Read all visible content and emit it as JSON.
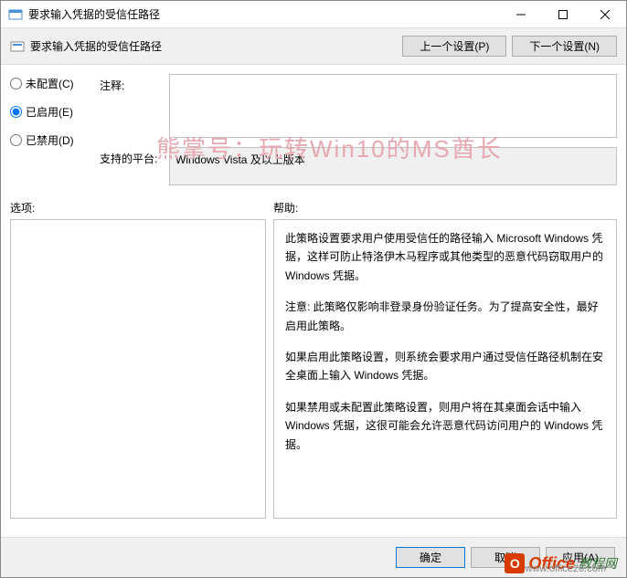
{
  "titlebar": {
    "title": "要求输入凭据的受信任路径"
  },
  "subheader": {
    "title": "要求输入凭据的受信任路径",
    "prev_btn": "上一个设置(P)",
    "next_btn": "下一个设置(N)"
  },
  "radios": {
    "not_configured": "未配置(C)",
    "enabled": "已启用(E)",
    "disabled": "已禁用(D)"
  },
  "fields": {
    "comment_label": "注释:",
    "comment_value": "",
    "platform_label": "支持的平台:",
    "platform_value": "Windows Vista 及以上版本"
  },
  "mid": {
    "options_label": "选项:",
    "help_label": "帮助:"
  },
  "help": {
    "p1": "此策略设置要求用户使用受信任的路径输入 Microsoft Windows 凭据，这样可防止特洛伊木马程序或其他类型的恶意代码窃取用户的 Windows 凭据。",
    "p2": "注意: 此策略仅影响非登录身份验证任务。为了提高安全性，最好启用此策略。",
    "p3": "如果启用此策略设置，则系统会要求用户通过受信任路径机制在安全桌面上输入 Windows 凭据。",
    "p4": "如果禁用或未配置此策略设置，则用户将在其桌面会话中输入 Windows 凭据，这很可能会允许恶意代码访问用户的 Windows 凭据。"
  },
  "footer": {
    "ok": "确定",
    "cancel": "取消",
    "apply": "应用(A)"
  },
  "watermark": {
    "text": "熊掌号：玩转Win10的MS酋长",
    "brand1": "Office",
    "brand2": "教程网",
    "url": "www.office26.com"
  }
}
